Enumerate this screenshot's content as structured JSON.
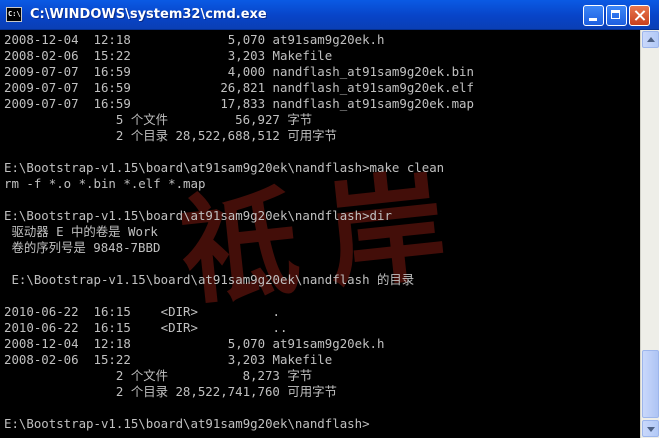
{
  "window": {
    "title": "C:\\WINDOWS\\system32\\cmd.exe",
    "icon_label": "C:\\"
  },
  "console": {
    "lines": [
      "2008-12-04  12:18             5,070 at91sam9g20ek.h",
      "2008-02-06  15:22             3,203 Makefile",
      "2009-07-07  16:59             4,000 nandflash_at91sam9g20ek.bin",
      "2009-07-07  16:59            26,821 nandflash_at91sam9g20ek.elf",
      "2009-07-07  16:59            17,833 nandflash_at91sam9g20ek.map",
      "               5 个文件         56,927 字节",
      "               2 个目录 28,522,688,512 可用字节",
      "",
      "E:\\Bootstrap-v1.15\\board\\at91sam9g20ek\\nandflash>make clean",
      "rm -f *.o *.bin *.elf *.map",
      "",
      "E:\\Bootstrap-v1.15\\board\\at91sam9g20ek\\nandflash>dir",
      " 驱动器 E 中的卷是 Work",
      " 卷的序列号是 9848-7BBD",
      "",
      " E:\\Bootstrap-v1.15\\board\\at91sam9g20ek\\nandflash 的目录",
      "",
      "2010-06-22  16:15    <DIR>          .",
      "2010-06-22  16:15    <DIR>          ..",
      "2008-12-04  12:18             5,070 at91sam9g20ek.h",
      "2008-02-06  15:22             3,203 Makefile",
      "               2 个文件          8,273 字节",
      "               2 个目录 28,522,741,760 可用字节",
      "",
      "E:\\Bootstrap-v1.15\\board\\at91sam9g20ek\\nandflash>"
    ]
  },
  "watermark": {
    "text": "祗 岸"
  },
  "colors": {
    "titlebar": "#0a5ae4",
    "console_bg": "#000000",
    "console_text": "#c0c0c0",
    "watermark": "#7a1a12"
  },
  "icons": {
    "minimize": "minimize-icon",
    "maximize": "maximize-icon",
    "close": "close-icon",
    "scroll_up": "arrow-up-icon",
    "scroll_down": "arrow-down-icon"
  }
}
